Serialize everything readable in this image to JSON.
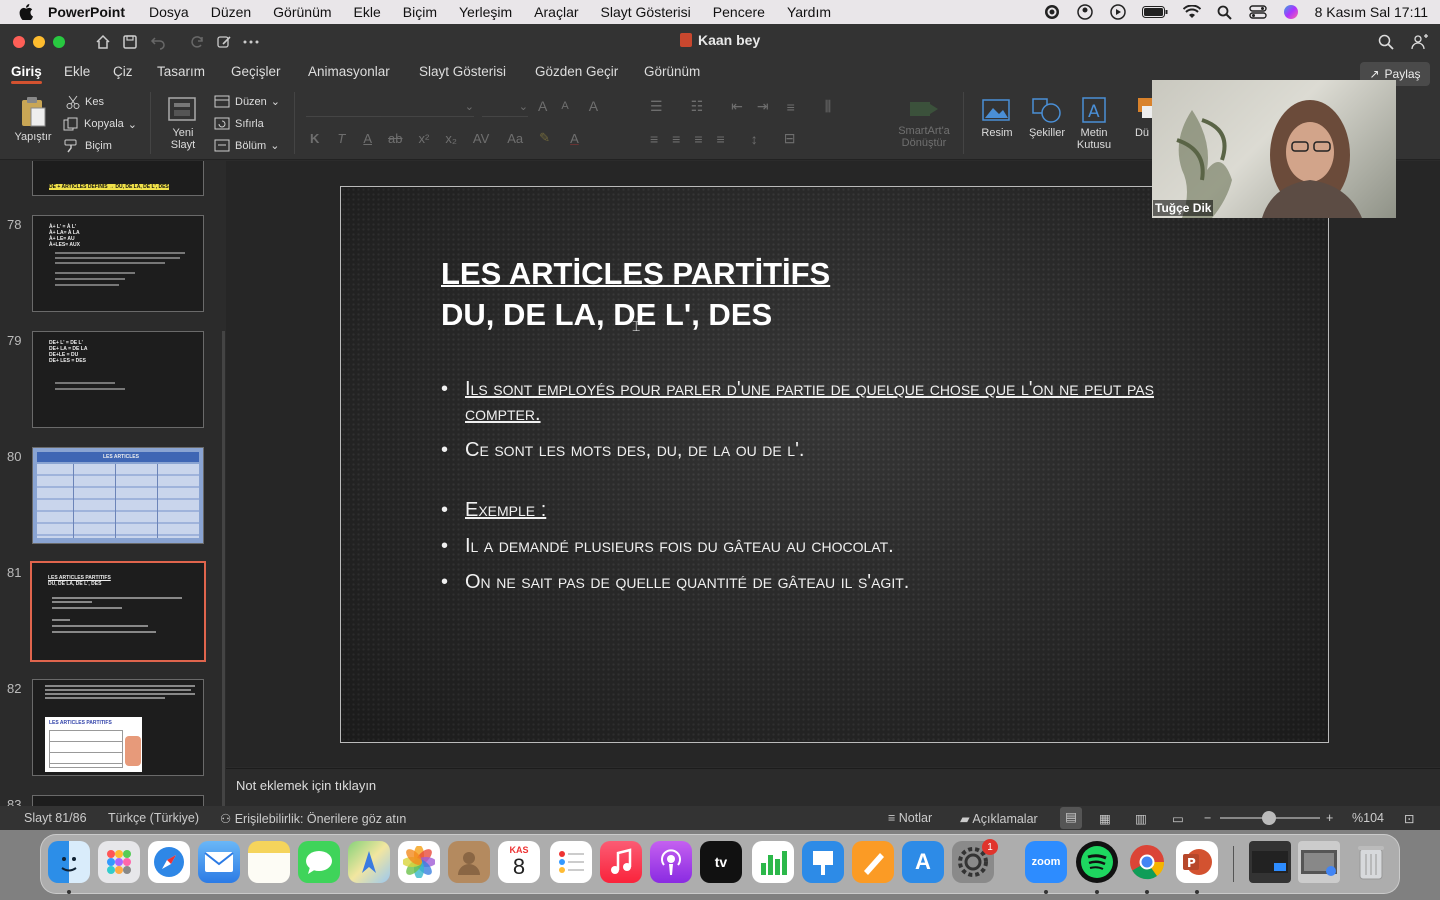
{
  "menubar": {
    "app": "PowerPoint",
    "items": [
      "Dosya",
      "Düzen",
      "Görünüm",
      "Ekle",
      "Biçim",
      "Yerleşim",
      "Araçlar",
      "Slayt Gösterisi",
      "Pencere",
      "Yardım"
    ],
    "clock": "8 Kasım Sal  17:11"
  },
  "window": {
    "title": "Kaan bey"
  },
  "tabs": [
    "Giriş",
    "Ekle",
    "Çiz",
    "Tasarım",
    "Geçişler",
    "Animasyonlar",
    "Slayt Gösterisi",
    "Gözden Geçir",
    "Görünüm"
  ],
  "share_label": "Paylaş",
  "ribbon": {
    "paste": "Yapıştır",
    "cut": "Kes",
    "copy": "Kopyala",
    "format": "Biçim",
    "new_slide": "Yeni Slayt",
    "layout": "Düzen",
    "reset": "Sıfırla",
    "section": "Bölüm",
    "smartart": "SmartArt'a Dönüştür",
    "picture": "Resim",
    "shapes": "Şekiller",
    "textbox": "Metin Kutusu",
    "cut_off": "Dü"
  },
  "thumbnails": [
    {
      "num": "",
      "lines": [
        "DE + ARTICLES DÉFINIS  → DU, DE LA, DE L', DES"
      ]
    },
    {
      "num": "78",
      "lines": [
        "À+ L' = À L'",
        "À+ LA= À LA",
        "À+ LE= AU",
        "À+LES= AUX"
      ]
    },
    {
      "num": "79",
      "lines": [
        "DE+ L' = DE L'",
        "DE+ LA = DE LA",
        "DE+LE = DU",
        "DE+ LES = DES"
      ]
    },
    {
      "num": "80",
      "lines": [
        "LES ARTICLES"
      ]
    },
    {
      "num": "81",
      "lines": [
        "LES ARTICLES PARTITIFS",
        "DU, DE LA, DE L', DES"
      ]
    },
    {
      "num": "82",
      "lines": [
        "LES ARTICLES PARTITIFS"
      ]
    },
    {
      "num": "83",
      "lines": []
    }
  ],
  "slide": {
    "title_line1": "LES ARTİCLES PARTİTİFS",
    "title_line2": "DU, DE LA, DE L', DES",
    "bullets": [
      "Ils sont employés pour parler d'une partie de quelque chose que l'on ne peut pas compter.",
      "Ce sont les mots des, du, de la ou de l'.",
      "Exemple :",
      "Il a demandé plusieurs fois du gâteau au chocolat.",
      "On ne sait pas de quelle quantité de gâteau il s'agit."
    ]
  },
  "notes_placeholder": "Not eklemek için tıklayın",
  "video": {
    "participant": "Tuğçe Dik"
  },
  "status": {
    "slide": "Slayt 81/86",
    "language": "Türkçe (Türkiye)",
    "accessibility": "Erişilebilirlik: Önerilere göz atın",
    "notes": "Notlar",
    "comments": "Açıklamalar",
    "zoom": "%104"
  },
  "dock": {
    "calendar_month": "KAS",
    "calendar_day": "8",
    "zoom_label": "zoom",
    "badge": "1"
  }
}
